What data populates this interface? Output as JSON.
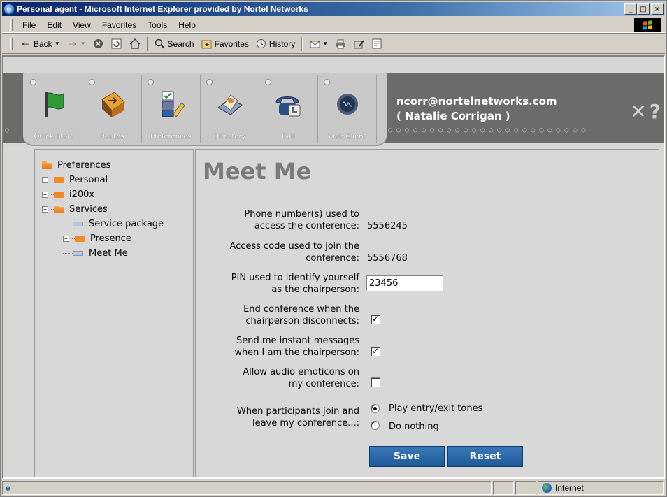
{
  "window": {
    "title": "Personal agent - Microsoft Internet Explorer provided by Nortel Networks",
    "controls": {
      "minimize": "_",
      "maximize": "□",
      "close": "×"
    }
  },
  "menubar": {
    "items": [
      "File",
      "Edit",
      "View",
      "Favorites",
      "Tools",
      "Help"
    ]
  },
  "toolbar": {
    "back": "Back",
    "search": "Search",
    "favorites": "Favorites",
    "history": "History"
  },
  "nav": {
    "items": [
      {
        "label": "Quick Start",
        "icon": "flag-icon"
      },
      {
        "label": "Routes",
        "icon": "routes-icon"
      },
      {
        "label": "Preferences",
        "icon": "checklist-icon"
      },
      {
        "label": "Directory",
        "icon": "directory-icon"
      },
      {
        "label": "Call",
        "icon": "phone-icon"
      },
      {
        "label": "Web Client",
        "icon": "web-client-icon"
      }
    ],
    "user_email": "ncorr@nortelnetworks.com",
    "user_name": "( Natalie Corrigan )",
    "close": "✕",
    "help": "?"
  },
  "tree": {
    "root": "Preferences",
    "items": [
      "Personal",
      "i200x",
      "Services",
      "Service package",
      "Presence",
      "Meet Me"
    ]
  },
  "main": {
    "title": "Meet Me",
    "phone_label_1": "Phone number(s) used to",
    "phone_label_2": "access the conference:",
    "phone_value": "5556245",
    "access_label_1": "Access code used to join the",
    "access_label_2": "conference:",
    "access_value": "5556768",
    "pin_label_1": "PIN used to identify yourself",
    "pin_label_2": "as the chairperson:",
    "pin_value": "23456",
    "end_label_1": "End conference when the",
    "end_label_2": "chairperson disconnects:",
    "end_checked": true,
    "im_label_1": "Send me instant messages",
    "im_label_2": "when I am the chairperson:",
    "im_checked": true,
    "emo_label_1": "Allow audio emoticons on",
    "emo_label_2": "my conference:",
    "emo_checked": false,
    "join_label_1": "When participants join and",
    "join_label_2": "leave my conference...:",
    "radio_options": [
      "Play entry/exit tones",
      "Do nothing"
    ],
    "radio_selected": "Play entry/exit tones",
    "save": "Save",
    "reset": "Reset"
  },
  "status": {
    "zone": "Internet"
  },
  "colors": {
    "title_bar": "#0a246a",
    "button": "#2a68a8",
    "banner_dark": "#6b6b6b",
    "heading": "#7b7b7b"
  }
}
